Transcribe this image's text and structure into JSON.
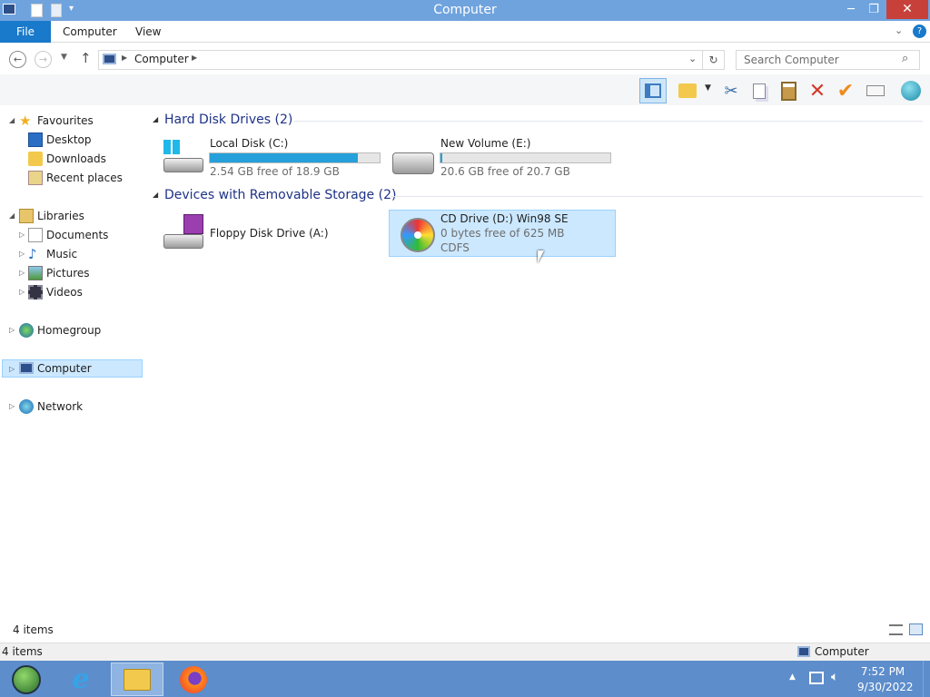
{
  "window": {
    "title": "Computer",
    "minimize_glyph": "─",
    "maximize_glyph": "❐",
    "close_glyph": "✕"
  },
  "ribbon": {
    "tabs": [
      "File",
      "Computer",
      "View"
    ]
  },
  "address": {
    "path_label": "Computer",
    "search_placeholder": "Search Computer"
  },
  "nav": {
    "favourites": "Favourites",
    "desktop": "Desktop",
    "downloads": "Downloads",
    "recent": "Recent places",
    "libraries": "Libraries",
    "documents": "Documents",
    "music": "Music",
    "pictures": "Pictures",
    "videos": "Videos",
    "homegroup": "Homegroup",
    "computer": "Computer",
    "network": "Network"
  },
  "content": {
    "group_hdd": "Hard Disk Drives (2)",
    "group_removable": "Devices with Removable Storage (2)",
    "drives": [
      {
        "name": "Local Disk (C:)",
        "free": "2.54 GB free of 18.9 GB",
        "used_fraction": 0.87
      },
      {
        "name": "New Volume (E:)",
        "free": "20.6 GB free of 20.7 GB",
        "used_fraction": 0.01
      }
    ],
    "floppy": {
      "name": "Floppy Disk Drive (A:)"
    },
    "cd": {
      "name": "CD Drive (D:) Win98 SE",
      "free": "0 bytes free of 625 MB",
      "fs": "CDFS"
    }
  },
  "status": {
    "items": "4 items",
    "items2": "4 items",
    "location": "Computer"
  },
  "taskbar": {
    "time": "7:52 PM",
    "date": "9/30/2022"
  },
  "colors": {
    "accent": "#1979ca",
    "title": "#6fa3de",
    "selection": "#cce8ff",
    "taskbar": "#5d8dcb"
  }
}
